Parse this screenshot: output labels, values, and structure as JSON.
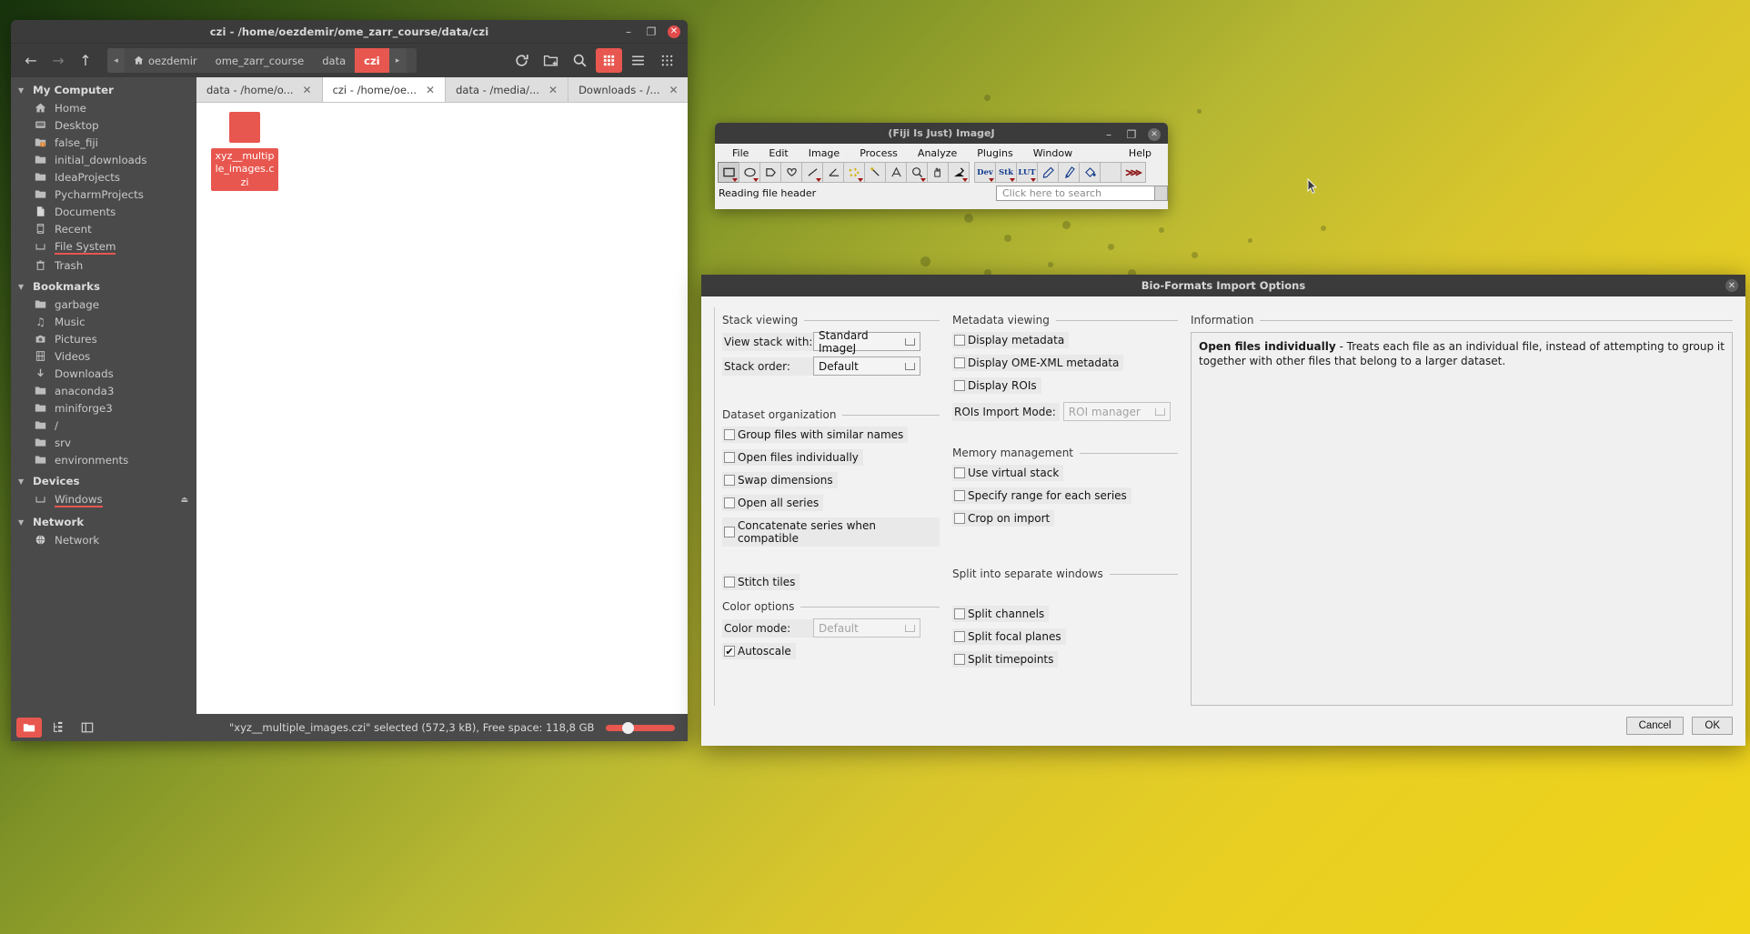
{
  "file_manager": {
    "title": "czi - /home/oezdemir/ome_zarr_course/data/czi",
    "window_controls": {
      "minimize": "–",
      "maximize": "❐",
      "close": "✕"
    },
    "nav": {
      "back": "←",
      "forward": "→",
      "up": "↑"
    },
    "breadcrumb": {
      "left_arrow": "◂",
      "right_arrow": "▸",
      "items": [
        {
          "label": "oezdemir",
          "icon": "home-icon",
          "active": false
        },
        {
          "label": "ome_zarr_course",
          "icon": "",
          "active": false
        },
        {
          "label": "data",
          "icon": "",
          "active": false
        },
        {
          "label": "czi",
          "icon": "",
          "active": true
        }
      ]
    },
    "toolbar_icons": [
      "reload-icon",
      "new-folder-icon",
      "search-icon",
      "grid-view-icon",
      "menu-icon",
      "apps-icon"
    ],
    "sidebar": {
      "groups": [
        {
          "label": "My Computer",
          "items": [
            {
              "label": "Home",
              "icon": "home-icon"
            },
            {
              "label": "Desktop",
              "icon": "desktop-icon"
            },
            {
              "label": "false_fiji",
              "icon": "folder-warning-icon"
            },
            {
              "label": "initial_downloads",
              "icon": "folder-icon"
            },
            {
              "label": "IdeaProjects",
              "icon": "folder-icon"
            },
            {
              "label": "PycharmProjects",
              "icon": "folder-icon"
            },
            {
              "label": "Documents",
              "icon": "document-icon"
            },
            {
              "label": "Recent",
              "icon": "recent-icon"
            },
            {
              "label": "File System",
              "icon": "drive-icon",
              "selected": true
            },
            {
              "label": "Trash",
              "icon": "trash-icon"
            }
          ]
        },
        {
          "label": "Bookmarks",
          "items": [
            {
              "label": "garbage",
              "icon": "folder-icon"
            },
            {
              "label": "Music",
              "icon": "music-icon"
            },
            {
              "label": "Pictures",
              "icon": "camera-icon"
            },
            {
              "label": "Videos",
              "icon": "film-icon"
            },
            {
              "label": "Downloads",
              "icon": "download-icon"
            },
            {
              "label": "anaconda3",
              "icon": "folder-icon"
            },
            {
              "label": "miniforge3",
              "icon": "folder-icon"
            },
            {
              "label": "/",
              "icon": "folder-icon"
            },
            {
              "label": "srv",
              "icon": "folder-icon"
            },
            {
              "label": "environments",
              "icon": "folder-icon"
            }
          ]
        },
        {
          "label": "Devices",
          "items": [
            {
              "label": "Windows",
              "icon": "drive-icon",
              "selected": true,
              "eject": "⏏"
            }
          ]
        },
        {
          "label": "Network",
          "items": [
            {
              "label": "Network",
              "icon": "network-icon"
            }
          ]
        }
      ]
    },
    "tabs": [
      {
        "label": "data - /home/o...",
        "active": false
      },
      {
        "label": "czi - /home/oe...",
        "active": true
      },
      {
        "label": "data - /media/...",
        "active": false
      },
      {
        "label": "Downloads - /...",
        "active": false
      }
    ],
    "files": [
      {
        "name": "xyz__multiple_images.czi",
        "selected": true
      }
    ],
    "status": {
      "text": "\"xyz__multiple_images.czi\" selected (572,3 kB), Free space: 118,8 GB",
      "buttons": [
        "folder-view-icon",
        "tree-view-icon",
        "split-view-icon"
      ]
    }
  },
  "imagej": {
    "title": "(Fiji Is Just) ImageJ",
    "window_controls": {
      "minimize": "–",
      "maximize": "❐",
      "close": "✕"
    },
    "menus": [
      "File",
      "Edit",
      "Image",
      "Process",
      "Analyze",
      "Plugins",
      "Window"
    ],
    "help_menu": "Help",
    "tools": [
      {
        "name": "rectangle-tool",
        "glyph": "rect",
        "selected": true,
        "dropdown": true
      },
      {
        "name": "oval-tool",
        "glyph": "oval",
        "dropdown": true
      },
      {
        "name": "polygon-tool",
        "glyph": "polygon",
        "dropdown": false
      },
      {
        "name": "freehand-tool",
        "glyph": "freehand",
        "dropdown": false
      },
      {
        "name": "line-tool",
        "glyph": "line",
        "dropdown": true
      },
      {
        "name": "angle-tool",
        "glyph": "angle",
        "dropdown": false
      },
      {
        "name": "point-tool",
        "glyph": "points",
        "dropdown": true
      },
      {
        "name": "wand-tool",
        "glyph": "wand",
        "dropdown": false
      },
      {
        "name": "text-tool",
        "glyph": "text",
        "dropdown": false
      },
      {
        "name": "magnifier-tool",
        "glyph": "magnifier",
        "dropdown": true
      },
      {
        "name": "hand-tool",
        "glyph": "hand",
        "dropdown": false
      },
      {
        "name": "dropper-tool",
        "glyph": "dropper",
        "dropdown": true
      },
      {
        "name": "dev-tool",
        "glyph": "Dev",
        "dropdown": true
      },
      {
        "name": "stk-tool",
        "glyph": "Stk",
        "dropdown": true
      },
      {
        "name": "lut-tool",
        "glyph": "LUT",
        "dropdown": true
      },
      {
        "name": "pencil-tool",
        "glyph": "pencil",
        "dropdown": false
      },
      {
        "name": "brush-tool",
        "glyph": "brush",
        "dropdown": false
      },
      {
        "name": "fill-tool",
        "glyph": "fill",
        "dropdown": false
      },
      {
        "name": "spacer-tool",
        "glyph": "",
        "dropdown": false
      },
      {
        "name": "more-tools",
        "glyph": "arrows",
        "dropdown": false
      }
    ],
    "status_text": "Reading file header",
    "search_placeholder": "Click here to search"
  },
  "bioformats": {
    "title": "Bio-Formats Import Options",
    "close_glyph": "✕",
    "groups": {
      "stack_viewing": {
        "title": "Stack viewing",
        "rows": [
          {
            "label": "View stack with:",
            "value": "Standard ImageJ",
            "disabled": false
          },
          {
            "label": "Stack order:",
            "value": "Default",
            "disabled": false
          }
        ]
      },
      "dataset_organization": {
        "title": "Dataset organization",
        "checkboxes": [
          {
            "label": "Group files with similar names",
            "checked": false
          },
          {
            "label": "Open files individually",
            "checked": false
          },
          {
            "label": "Swap dimensions",
            "checked": false
          },
          {
            "label": "Open all series",
            "checked": false
          },
          {
            "label": "Concatenate series when compatible",
            "checked": false
          },
          {
            "label": "Stitch tiles",
            "checked": false
          }
        ]
      },
      "color_options": {
        "title": "Color options",
        "combo": {
          "label": "Color mode:",
          "value": "Default",
          "disabled": true
        },
        "checkboxes": [
          {
            "label": "Autoscale",
            "checked": true
          }
        ]
      },
      "metadata_viewing": {
        "title": "Metadata viewing",
        "checkboxes": [
          {
            "label": "Display metadata",
            "checked": false
          },
          {
            "label": "Display OME-XML metadata",
            "checked": false
          },
          {
            "label": "Display ROIs",
            "checked": false
          }
        ],
        "combo": {
          "label": "ROIs Import Mode:",
          "value": "ROI manager",
          "disabled": true
        }
      },
      "memory_management": {
        "title": "Memory management",
        "checkboxes": [
          {
            "label": "Use virtual stack",
            "checked": false
          },
          {
            "label": "Specify range for each series",
            "checked": false
          },
          {
            "label": "Crop on import",
            "checked": false
          }
        ]
      },
      "split_windows": {
        "title": "Split into separate windows",
        "checkboxes": [
          {
            "label": "Split channels",
            "checked": false
          },
          {
            "label": "Split focal planes",
            "checked": false
          },
          {
            "label": "Split timepoints",
            "checked": false
          }
        ]
      },
      "information": {
        "title": "Information",
        "heading": "Open files individually",
        "body": " - Treats each file as an individual file, instead of attempting to group it together with other files that belong to a larger dataset."
      }
    },
    "buttons": {
      "cancel": "Cancel",
      "ok": "OK"
    }
  },
  "colors": {
    "accent_red": "#e8574f",
    "window_dark": "#3b3b3b",
    "sidebar": "#4a4a4a",
    "dialog_bg": "#f2f2f2"
  }
}
